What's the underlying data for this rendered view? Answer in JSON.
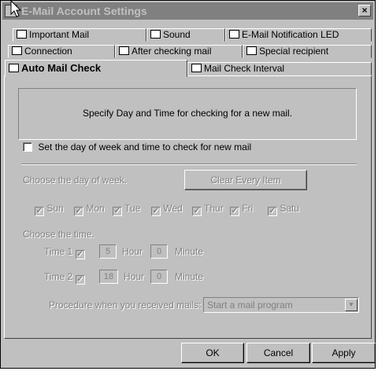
{
  "window": {
    "title": "E-Mail Account Settings",
    "close_label": "×"
  },
  "tabs_row1": [
    {
      "label": "Important Mail"
    },
    {
      "label": "Sound"
    },
    {
      "label": "E-Mail Notification LED"
    }
  ],
  "tabs_row2": [
    {
      "label": "Connection"
    },
    {
      "label": "After checking mail"
    },
    {
      "label": "Special recipient"
    }
  ],
  "tabs_row3": [
    {
      "label": "Auto Mail Check",
      "active": true
    },
    {
      "label": "Mail Check Interval"
    }
  ],
  "info_text": "Specify Day and Time for checking for a new mail.",
  "enable_checkbox": {
    "label": "Set the day of week and time to check for new mail",
    "checked": false
  },
  "day_section": {
    "label": "Choose the day of week.",
    "clear_button": "Clear Every Item",
    "days": [
      "Sun",
      "Mon",
      "Tue",
      "Wed",
      "Thur",
      "Fri",
      "Satu"
    ]
  },
  "time_section": {
    "label": "Choose the time.",
    "time1": {
      "label": "Time 1",
      "hour": "5",
      "hour_label": "Hour",
      "minute": "0",
      "minute_label": "Minute"
    },
    "time2": {
      "label": "Time 2",
      "hour": "18",
      "hour_label": "Hour",
      "minute": "0",
      "minute_label": "Minute"
    }
  },
  "procedure": {
    "label": "Procedure when you received mails:",
    "value": "Start a mail program"
  },
  "buttons": {
    "ok": "OK",
    "cancel": "Cancel",
    "apply": "Apply"
  }
}
